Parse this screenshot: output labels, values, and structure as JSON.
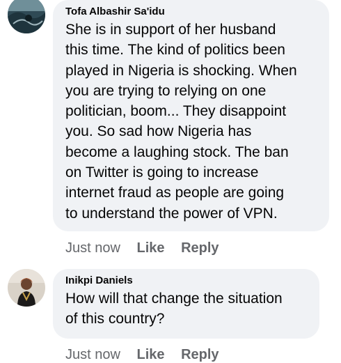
{
  "comments": [
    {
      "author": "Tofa Albashir Sa'idu",
      "lines": [
        "She is in support of her husband",
        "this time. The kind of politics been",
        "played in Nigeria is shocking. When",
        "you are trying to relying on one",
        "politician, boom... They disappoint",
        "you. So sad how Nigeria has",
        "become a laughing stock. The ban",
        "on Twitter is going to increase",
        "internet fraud as people are going",
        "to understand the power of VPN."
      ],
      "time": "Just now",
      "like_label": "Like",
      "reply_label": "Reply"
    },
    {
      "author": "Inikpi Daniels",
      "lines": [
        "How will that change the situation",
        "of this country?"
      ],
      "time": "Just now",
      "like_label": "Like",
      "reply_label": "Reply"
    }
  ],
  "colors": {
    "bubble": "#f0f2f5",
    "text": "#050505",
    "meta": "#65676b"
  }
}
